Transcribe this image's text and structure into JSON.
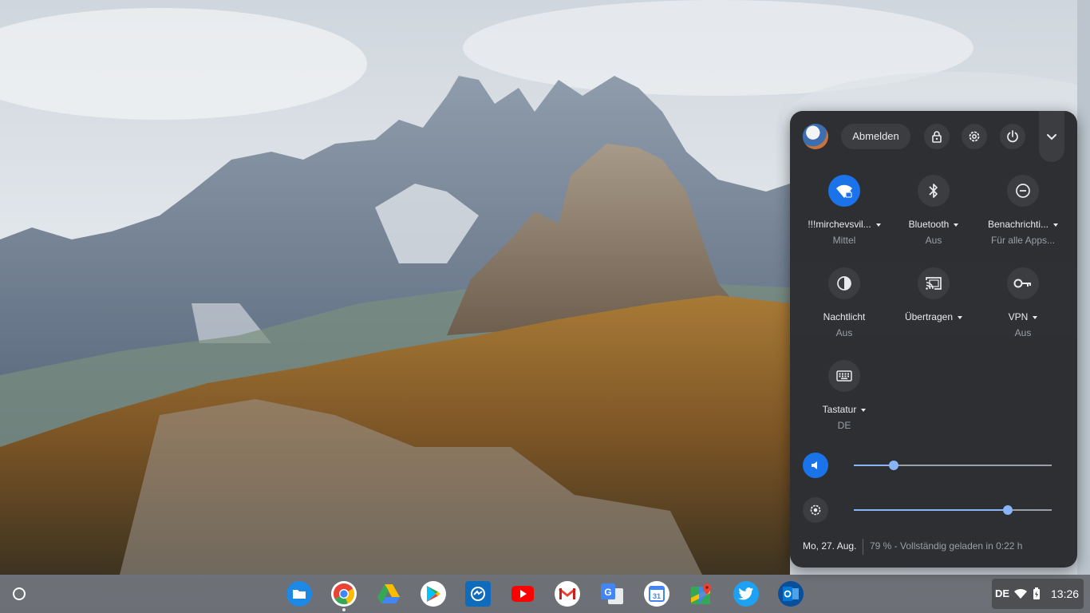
{
  "quick_settings": {
    "sign_out_label": "Abmelden",
    "features": [
      {
        "label": "!!!mirchevsvil...",
        "sub": "Mittel",
        "icon": "wifi-lock-icon",
        "active": true,
        "has_menu": true
      },
      {
        "label": "Bluetooth",
        "sub": "Aus",
        "icon": "bluetooth-icon",
        "active": false,
        "has_menu": true
      },
      {
        "label": "Benachrichti...",
        "sub": "Für alle Apps...",
        "icon": "do-not-disturb-icon",
        "active": false,
        "has_menu": true
      },
      {
        "label": "Nachtlicht",
        "sub": "Aus",
        "icon": "night-light-icon",
        "active": false,
        "has_menu": false
      },
      {
        "label": "Übertragen",
        "sub": "",
        "icon": "cast-icon",
        "active": false,
        "has_menu": true
      },
      {
        "label": "VPN",
        "sub": "Aus",
        "icon": "vpn-key-icon",
        "active": false,
        "has_menu": true
      },
      {
        "label": "Tastatur",
        "sub": "DE",
        "icon": "keyboard-icon",
        "active": false,
        "has_menu": true
      }
    ],
    "volume_level": 0.2,
    "brightness_level": 0.78,
    "date": "Mo, 27. Aug.",
    "battery_status": "79 % - Vollständig geladen in 0:22 h"
  },
  "shelf": {
    "apps": [
      {
        "name": "files-app",
        "icon": "folder-icon",
        "color": "#1e88e5"
      },
      {
        "name": "chrome-app",
        "icon": "chrome-icon",
        "color": "#ea4335"
      },
      {
        "name": "drive-app",
        "icon": "drive-icon",
        "color": "#fbbc04"
      },
      {
        "name": "play-store-app",
        "icon": "play-store-icon",
        "color": "#34a853"
      },
      {
        "name": "messenger-app",
        "icon": "messenger-icon",
        "color": "#0f6cbd"
      },
      {
        "name": "youtube-app",
        "icon": "youtube-icon",
        "color": "#ff0000"
      },
      {
        "name": "gmail-app",
        "icon": "gmail-icon",
        "color": "#ea4335"
      },
      {
        "name": "translate-app",
        "icon": "translate-icon",
        "color": "#4285f4"
      },
      {
        "name": "calendar-app",
        "icon": "calendar-icon",
        "color": "#4285f4"
      },
      {
        "name": "maps-app",
        "icon": "maps-icon",
        "color": "#34a853"
      },
      {
        "name": "twitter-app",
        "icon": "twitter-icon",
        "color": "#1da1f2"
      },
      {
        "name": "outlook-app",
        "icon": "outlook-icon",
        "color": "#0078d4"
      }
    ],
    "input_method": "DE",
    "time": "13:26",
    "calendar_day": "31"
  },
  "colors": {
    "accent": "#1a73e8",
    "slider": "#8ab4f8",
    "panel": "#26282b"
  }
}
